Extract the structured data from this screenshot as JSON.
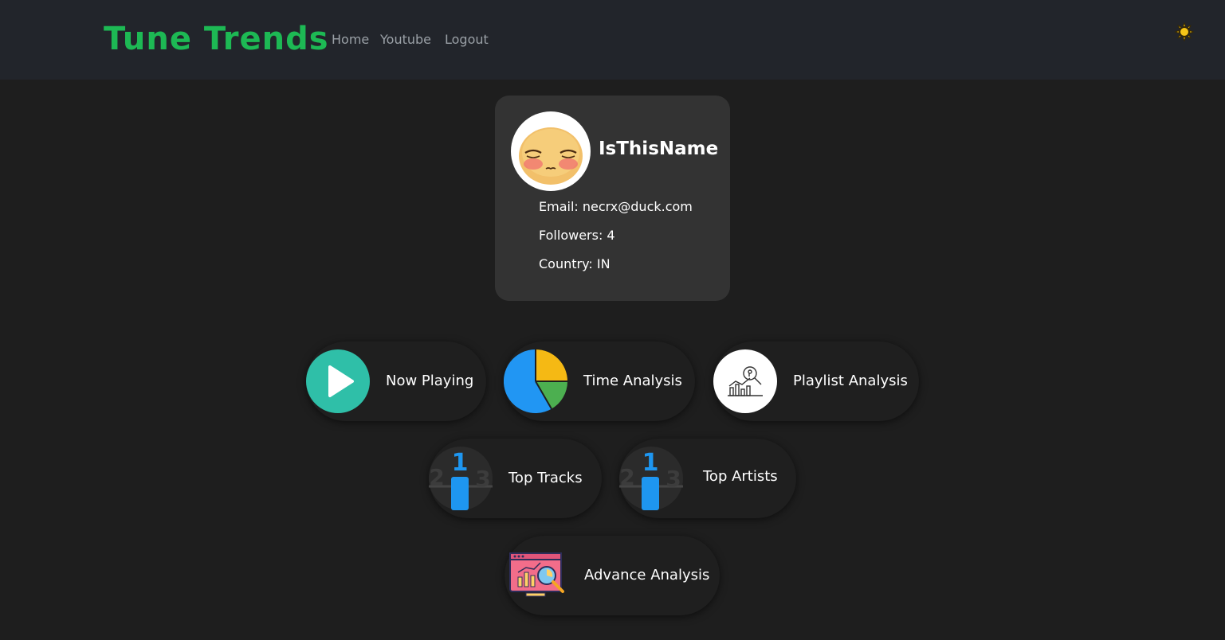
{
  "app": {
    "title": "Tune Trends",
    "brand_color": "#1db954"
  },
  "nav": {
    "links": [
      {
        "label": "Home"
      },
      {
        "label": "Youtube"
      },
      {
        "label": "Logout"
      }
    ],
    "theme_toggle_icon": "sun-icon"
  },
  "profile": {
    "username": "IsThisName",
    "avatar_icon": "blushing-face-avatar",
    "email_line": "Email: necrx@duck.com",
    "followers_line": "Followers: 4",
    "country_line": "Country: IN"
  },
  "features": [
    {
      "label": "Now Playing",
      "icon": "play-icon"
    },
    {
      "label": "Time Analysis",
      "icon": "pie-chart-icon"
    },
    {
      "label": "Playlist Analysis",
      "icon": "chart-search-icon"
    },
    {
      "label": "Top Tracks",
      "icon": "podium-icon"
    },
    {
      "label": "Top Artists",
      "icon": "podium-icon"
    },
    {
      "label": "Advance Analysis",
      "icon": "monitor-analysis-icon"
    }
  ]
}
